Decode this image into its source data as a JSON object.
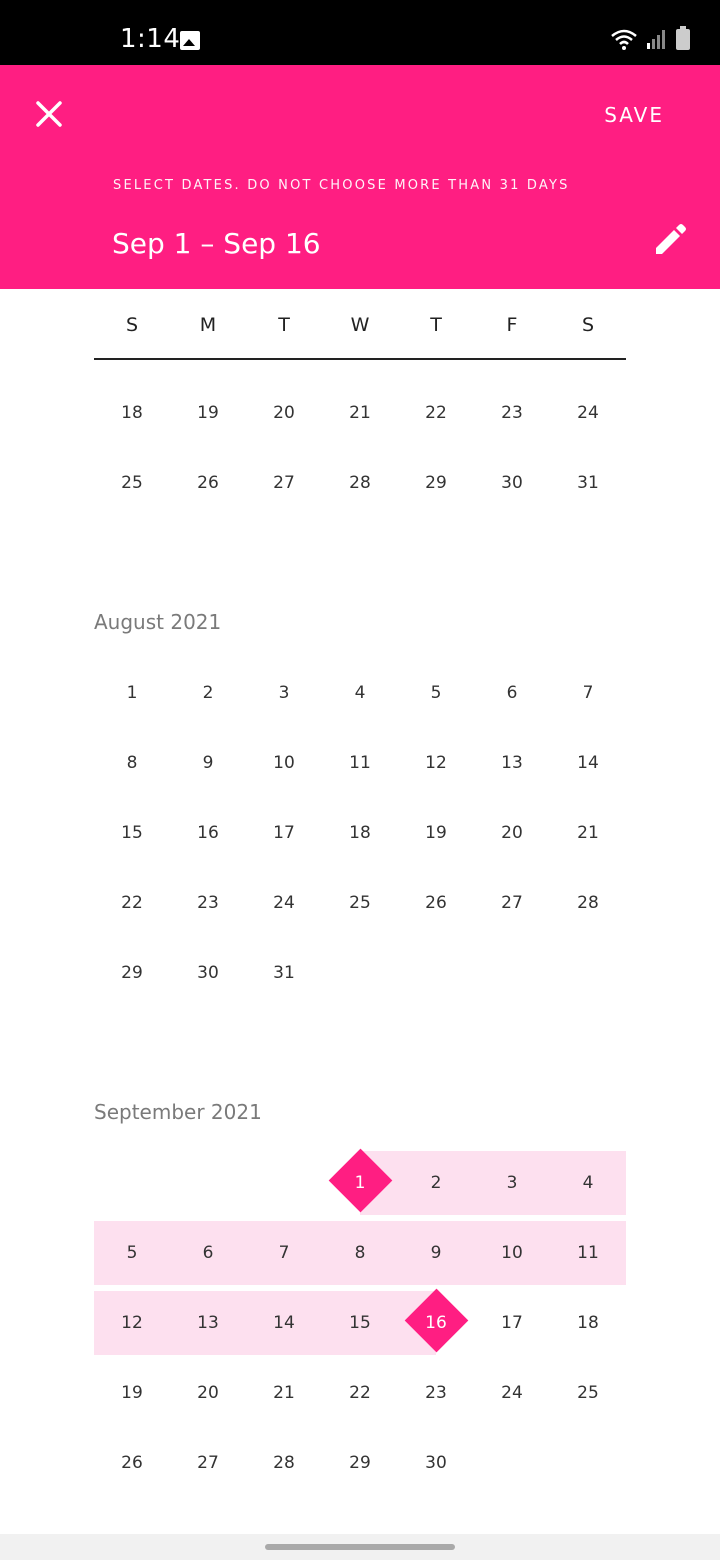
{
  "status": {
    "time": "1:14"
  },
  "header": {
    "save_label": "SAVE",
    "instruction": "SELECT DATES. DO NOT CHOOSE MORE THAN 31 DAYS",
    "range": "Sep 1 – Sep 16"
  },
  "weekdays": [
    "S",
    "M",
    "T",
    "W",
    "T",
    "F",
    "S"
  ],
  "months": [
    {
      "title": "",
      "rows": [
        [
          "18",
          "19",
          "20",
          "21",
          "22",
          "23",
          "24"
        ],
        [
          "25",
          "26",
          "27",
          "28",
          "29",
          "30",
          "31"
        ]
      ]
    },
    {
      "title": "August 2021",
      "rows": [
        [
          "1",
          "2",
          "3",
          "4",
          "5",
          "6",
          "7"
        ],
        [
          "8",
          "9",
          "10",
          "11",
          "12",
          "13",
          "14"
        ],
        [
          "15",
          "16",
          "17",
          "18",
          "19",
          "20",
          "21"
        ],
        [
          "22",
          "23",
          "24",
          "25",
          "26",
          "27",
          "28"
        ],
        [
          "29",
          "30",
          "31",
          "",
          "",
          "",
          ""
        ]
      ]
    },
    {
      "title": "September 2021",
      "rows": [
        [
          "",
          "",
          "",
          "1",
          "2",
          "3",
          "4"
        ],
        [
          "5",
          "6",
          "7",
          "8",
          "9",
          "10",
          "11"
        ],
        [
          "12",
          "13",
          "14",
          "15",
          "16",
          "17",
          "18"
        ],
        [
          "19",
          "20",
          "21",
          "22",
          "23",
          "24",
          "25"
        ],
        [
          "26",
          "27",
          "28",
          "29",
          "30",
          "",
          ""
        ]
      ]
    }
  ],
  "selection": {
    "start": "1",
    "end": "16"
  },
  "colors": {
    "accent": "#ff1e82",
    "range_fill": "#fde0ef"
  }
}
